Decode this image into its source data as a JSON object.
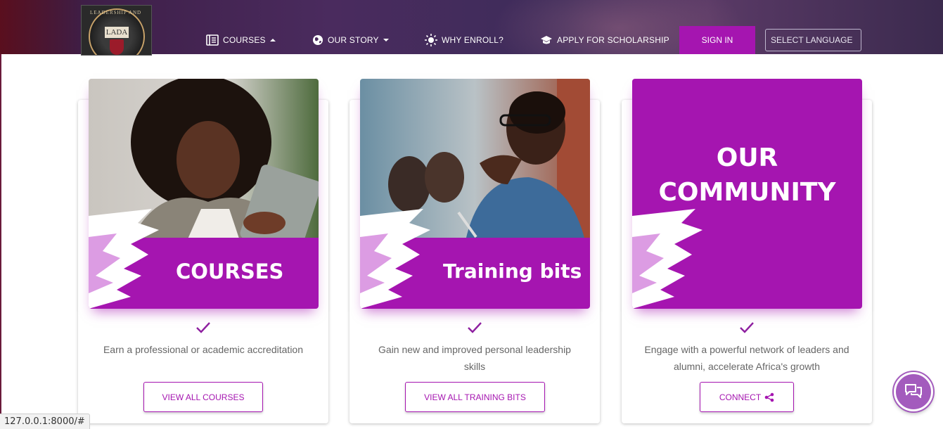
{
  "nav": {
    "courses": "COURSES",
    "our_story": "OUR STORY",
    "why_enroll": "WHY ENROLL?",
    "apply": "APPLY FOR SCHOLARSHIP",
    "sign_in": "SIGN IN",
    "language": "SELECT LANGUAGE"
  },
  "logo": {
    "text": "LADA",
    "arc_text": "LEADERSHIP AND DEVELOPMENT ACADEMY"
  },
  "cards": [
    {
      "title": "COURSES",
      "desc_line1": "Earn a professional or academic accreditation",
      "desc_line2": "",
      "button": "VIEW ALL COURSES"
    },
    {
      "title": "Training bits",
      "desc_line1": "Gain new and improved personal leadership",
      "desc_line2": "skills",
      "button": "VIEW ALL TRAINING BITS"
    },
    {
      "title_line1": "OUR",
      "title_line2": "COMMUNITY",
      "desc_line1": "Engage with a powerful network of leaders and",
      "desc_line2": "alumni, accelerate Africa's growth",
      "button": "CONNECT"
    }
  ],
  "status_url": "127.0.0.1:8000/#",
  "colors": {
    "accent": "#a515b0",
    "check": "#8e1fa0"
  },
  "icons": [
    "book-icon",
    "globe-icon",
    "sun-icon",
    "graduation-cap-icon",
    "check-icon",
    "share-icon",
    "chat-icon"
  ]
}
